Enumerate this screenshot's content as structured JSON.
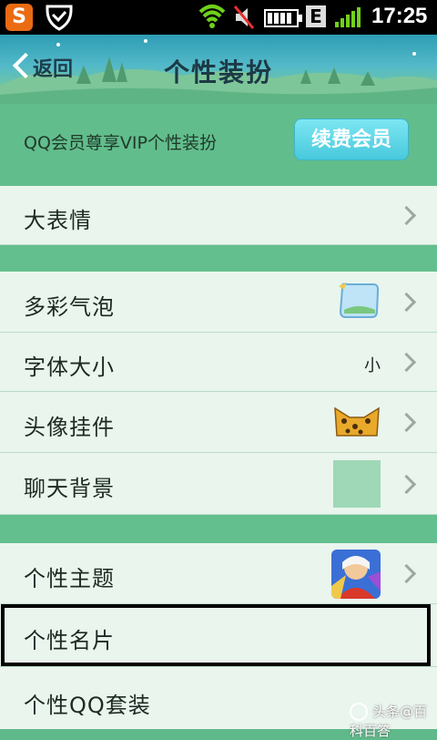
{
  "status_bar": {
    "time": "17:25",
    "indicator": "E",
    "icons": [
      "sogou-icon",
      "shield-icon",
      "wifi-icon",
      "mute-icon",
      "battery-icon",
      "signal-icon"
    ]
  },
  "header": {
    "back_label": "返回",
    "title": "个性装扮"
  },
  "banner": {
    "text": "QQ会员尊享VIP个性装扮",
    "button_label": "续费会员"
  },
  "menu": {
    "big_emoji": "大表情",
    "bubbles": "多彩气泡",
    "font_size": "字体大小",
    "font_size_preview": "小",
    "avatar_pendant": "头像挂件",
    "chat_bg": "聊天背景",
    "theme": "个性主题",
    "card": "个性名片",
    "suite": "个性QQ套装"
  },
  "watermark": "头条@百科百答",
  "colors": {
    "header": "#3aa8b9",
    "section": "#62bd8c",
    "row": "#eaf5ee",
    "button": "#5ad7e8"
  }
}
